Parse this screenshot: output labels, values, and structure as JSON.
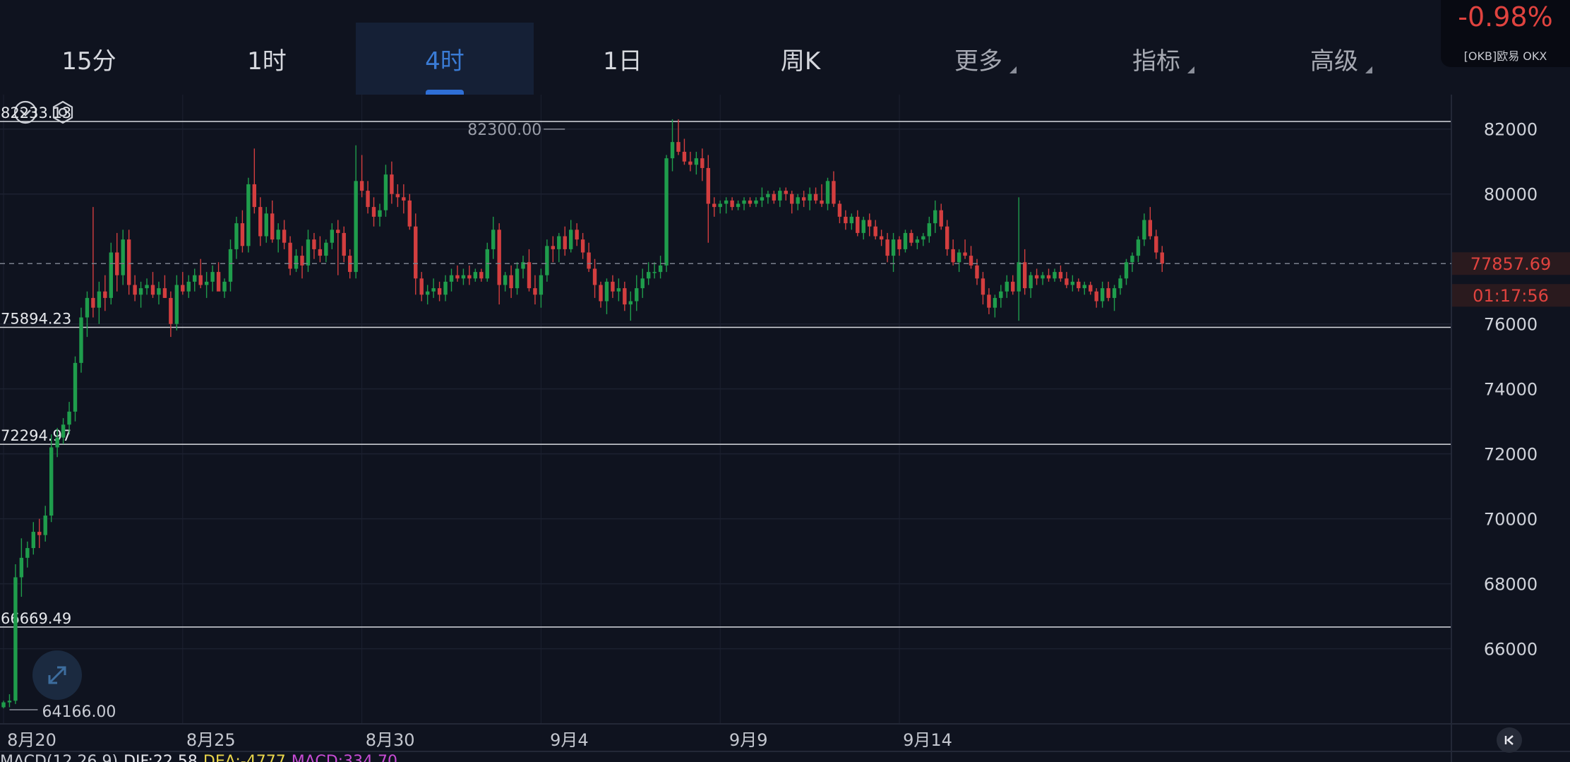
{
  "tabs": [
    {
      "label": "15分",
      "active": false
    },
    {
      "label": "1时",
      "active": false
    },
    {
      "label": "4时",
      "active": true
    },
    {
      "label": "1日",
      "active": false
    },
    {
      "label": "周K",
      "active": false
    },
    {
      "label": "更多",
      "active": false,
      "dropdown": true
    },
    {
      "label": "指标",
      "active": false,
      "dropdown": true
    },
    {
      "label": "高级",
      "active": false,
      "dropdown": true
    }
  ],
  "ticker": {
    "change": "-0.98%",
    "source": "[OKB]欧易 OKX",
    "change_color": "#e0433f"
  },
  "icons": {
    "collapse": "chevron-down-circle-icon",
    "settings": "hexagon-settings-icon",
    "expand": "expand-arrows-icon",
    "back": "skip-to-start-icon"
  },
  "macd": {
    "label": "MACD(12,26,9)",
    "dif": "DIF:22.58",
    "dea": "DEA:-4777",
    "macd": "MACD:334.70"
  },
  "colors": {
    "up": "#1f9d4c",
    "down": "#d33e3f",
    "background": "#0f131f",
    "grid": "#1c2130"
  },
  "chart_data": {
    "type": "candlestick",
    "y_ticks": [
      82000,
      80000,
      76000,
      74000,
      72000,
      70000,
      68000,
      66000
    ],
    "ylim": [
      63500,
      83500
    ],
    "x_ticks": [
      {
        "label": "8月20",
        "index": 0
      },
      {
        "label": "8月25",
        "index": 30
      },
      {
        "label": "8月30",
        "index": 60
      },
      {
        "label": "9月4",
        "index": 90
      },
      {
        "label": "9月9",
        "index": 120
      },
      {
        "label": "9月14",
        "index": 150
      }
    ],
    "levels": [
      {
        "label": "82233.13",
        "value": 82233.13
      },
      {
        "label": "75894.23",
        "value": 75894.23
      },
      {
        "label": "72294.97",
        "value": 72294.97
      },
      {
        "label": "66669.49",
        "value": 66669.49
      }
    ],
    "current_price": {
      "value": 77857.69,
      "label": "77857.69",
      "countdown": "01:17:56"
    },
    "high_marker": {
      "label": "82300.00",
      "value": 82300,
      "index": 94
    },
    "low_marker": {
      "label": "64166.00",
      "value": 64166,
      "index": 1
    },
    "candles_ohlc": [
      [
        64200,
        64400,
        64166,
        64350
      ],
      [
        64350,
        64600,
        64200,
        64400
      ],
      [
        64400,
        68600,
        64300,
        68200
      ],
      [
        68200,
        69400,
        67600,
        68800
      ],
      [
        68800,
        69300,
        68500,
        69100
      ],
      [
        69100,
        69900,
        68900,
        69600
      ],
      [
        69600,
        70000,
        69100,
        69500
      ],
      [
        69500,
        70400,
        69300,
        70100
      ],
      [
        70100,
        72600,
        69900,
        72200
      ],
      [
        72200,
        72800,
        71900,
        72500
      ],
      [
        72500,
        73100,
        72300,
        72900
      ],
      [
        72900,
        73600,
        72600,
        73300
      ],
      [
        73300,
        75000,
        73000,
        74800
      ],
      [
        74800,
        76500,
        74500,
        76200
      ],
      [
        76200,
        77000,
        75600,
        76800
      ],
      [
        76800,
        79600,
        76200,
        76500
      ],
      [
        76500,
        77300,
        76000,
        77000
      ],
      [
        77000,
        77500,
        76400,
        76800
      ],
      [
        76800,
        78500,
        76600,
        78200
      ],
      [
        78200,
        78800,
        77000,
        77500
      ],
      [
        77500,
        78900,
        77200,
        78600
      ],
      [
        78600,
        78900,
        76900,
        77200
      ],
      [
        77200,
        77500,
        76700,
        76900
      ],
      [
        76900,
        77300,
        76500,
        77100
      ],
      [
        77100,
        77400,
        76900,
        77200
      ],
      [
        77200,
        77600,
        76800,
        76900
      ],
      [
        76900,
        77300,
        76600,
        77100
      ],
      [
        77100,
        77500,
        76800,
        76800
      ],
      [
        76800,
        77000,
        75600,
        76000
      ],
      [
        76000,
        77500,
        75800,
        77200
      ],
      [
        77200,
        77600,
        76900,
        77000
      ],
      [
        77000,
        77500,
        76800,
        77300
      ],
      [
        77300,
        77700,
        77000,
        77500
      ],
      [
        77500,
        78000,
        77100,
        77200
      ],
      [
        77200,
        77600,
        76800,
        77300
      ],
      [
        77300,
        77800,
        77000,
        77600
      ],
      [
        77600,
        77900,
        77100,
        77000
      ],
      [
        77000,
        77400,
        76800,
        77300
      ],
      [
        77300,
        78600,
        77000,
        78300
      ],
      [
        78300,
        79300,
        78000,
        79100
      ],
      [
        79100,
        79500,
        78200,
        78400
      ],
      [
        78400,
        80500,
        78200,
        80300
      ],
      [
        80300,
        81400,
        79400,
        79600
      ],
      [
        79600,
        79900,
        78400,
        78700
      ],
      [
        78700,
        79600,
        78500,
        79400
      ],
      [
        79400,
        79800,
        78500,
        78600
      ],
      [
        78600,
        79100,
        78200,
        78900
      ],
      [
        78900,
        79200,
        78300,
        78500
      ],
      [
        78500,
        78700,
        77500,
        77700
      ],
      [
        77700,
        78300,
        77600,
        78100
      ],
      [
        78100,
        78400,
        77400,
        77800
      ],
      [
        77800,
        78900,
        77600,
        78600
      ],
      [
        78600,
        78800,
        78000,
        78300
      ],
      [
        78300,
        78700,
        77900,
        78100
      ],
      [
        78100,
        78600,
        77900,
        78500
      ],
      [
        78500,
        79100,
        78300,
        78900
      ],
      [
        78900,
        79200,
        77500,
        78800
      ],
      [
        78800,
        79000,
        77900,
        78100
      ],
      [
        78100,
        78300,
        77400,
        77600
      ],
      [
        77600,
        81500,
        77400,
        80400
      ],
      [
        80400,
        81200,
        79900,
        80100
      ],
      [
        80100,
        80400,
        79400,
        79600
      ],
      [
        79600,
        79900,
        79000,
        79300
      ],
      [
        79300,
        79700,
        79000,
        79500
      ],
      [
        79500,
        80900,
        79300,
        80600
      ],
      [
        80600,
        81000,
        79700,
        80000
      ],
      [
        80000,
        80300,
        79600,
        79900
      ],
      [
        79900,
        80300,
        79400,
        79800
      ],
      [
        79800,
        80000,
        78900,
        79000
      ],
      [
        79000,
        79400,
        76900,
        77400
      ],
      [
        77400,
        77600,
        76700,
        76900
      ],
      [
        76900,
        77200,
        76600,
        77000
      ],
      [
        77000,
        77400,
        76800,
        77100
      ],
      [
        77100,
        77300,
        76700,
        76900
      ],
      [
        76900,
        77500,
        76700,
        77300
      ],
      [
        77300,
        77700,
        77000,
        77500
      ],
      [
        77500,
        77800,
        77300,
        77400
      ],
      [
        77400,
        77700,
        77200,
        77500
      ],
      [
        77500,
        77800,
        77200,
        77400
      ],
      [
        77400,
        77700,
        77300,
        77600
      ],
      [
        77600,
        77700,
        77300,
        77400
      ],
      [
        77400,
        78500,
        77300,
        78300
      ],
      [
        78300,
        79300,
        78000,
        78900
      ],
      [
        78900,
        79100,
        76600,
        77200
      ],
      [
        77200,
        77600,
        77000,
        77500
      ],
      [
        77500,
        77800,
        76800,
        77100
      ],
      [
        77100,
        77900,
        76900,
        77700
      ],
      [
        77700,
        78100,
        77400,
        77900
      ],
      [
        77900,
        78300,
        77000,
        77100
      ],
      [
        77100,
        77500,
        76600,
        76900
      ],
      [
        76900,
        77700,
        76500,
        77500
      ],
      [
        77500,
        78600,
        77300,
        78400
      ],
      [
        78400,
        78700,
        77900,
        78300
      ],
      [
        78300,
        78800,
        77900,
        78700
      ],
      [
        78700,
        79000,
        78100,
        78300
      ],
      [
        78300,
        79200,
        78200,
        78900
      ],
      [
        78900,
        79100,
        78400,
        78600
      ],
      [
        78600,
        78800,
        78000,
        78200
      ],
      [
        78200,
        78500,
        77600,
        77700
      ],
      [
        77700,
        78000,
        76800,
        77200
      ],
      [
        77200,
        77300,
        76500,
        76700
      ],
      [
        76700,
        77400,
        76300,
        77300
      ],
      [
        77300,
        77500,
        76800,
        77000
      ],
      [
        77000,
        77400,
        76700,
        77100
      ],
      [
        77100,
        77300,
        76400,
        76600
      ],
      [
        76600,
        77000,
        76100,
        76700
      ],
      [
        76700,
        77500,
        76400,
        77100
      ],
      [
        77100,
        77700,
        76800,
        77400
      ],
      [
        77400,
        77900,
        77200,
        77600
      ],
      [
        77600,
        77900,
        77400,
        77600
      ],
      [
        77600,
        78100,
        77400,
        77800
      ],
      [
        77800,
        81200,
        77600,
        81100
      ],
      [
        81100,
        82300,
        80700,
        81600
      ],
      [
        81600,
        82300,
        81200,
        81300
      ],
      [
        81300,
        81700,
        80900,
        81000
      ],
      [
        81000,
        81300,
        80700,
        80900
      ],
      [
        80900,
        81300,
        80600,
        81100
      ],
      [
        81100,
        81400,
        80400,
        80800
      ],
      [
        80800,
        81200,
        78500,
        79700
      ],
      [
        79700,
        79900,
        79300,
        79600
      ],
      [
        79600,
        79800,
        79400,
        79700
      ],
      [
        79700,
        79900,
        79400,
        79800
      ],
      [
        79800,
        79900,
        79500,
        79600
      ],
      [
        79600,
        79800,
        79500,
        79700
      ],
      [
        79700,
        79900,
        79500,
        79800
      ],
      [
        79800,
        79900,
        79600,
        79700
      ],
      [
        79700,
        79900,
        79600,
        79800
      ],
      [
        79800,
        80200,
        79600,
        79900
      ],
      [
        79900,
        80100,
        79700,
        80000
      ],
      [
        80000,
        80100,
        79700,
        79800
      ],
      [
        79800,
        80200,
        79600,
        80100
      ],
      [
        80100,
        80200,
        79800,
        80000
      ],
      [
        80000,
        80100,
        79400,
        79700
      ],
      [
        79700,
        80000,
        79500,
        79900
      ],
      [
        79900,
        80100,
        79600,
        79800
      ],
      [
        79800,
        80200,
        79500,
        80000
      ],
      [
        80000,
        80200,
        79700,
        79800
      ],
      [
        79800,
        80300,
        79600,
        79700
      ],
      [
        79700,
        80500,
        79500,
        80400
      ],
      [
        80400,
        80700,
        79600,
        79700
      ],
      [
        79700,
        79800,
        79100,
        79300
      ],
      [
        79300,
        79500,
        78900,
        79100
      ],
      [
        79100,
        79400,
        78900,
        79300
      ],
      [
        79300,
        79500,
        78700,
        78800
      ],
      [
        78800,
        79300,
        78600,
        79200
      ],
      [
        79200,
        79400,
        78700,
        79000
      ],
      [
        79000,
        79200,
        78600,
        78700
      ],
      [
        78700,
        78900,
        78400,
        78600
      ],
      [
        78600,
        78800,
        77900,
        78100
      ],
      [
        78100,
        78800,
        77600,
        78600
      ],
      [
        78600,
        78700,
        78100,
        78300
      ],
      [
        78300,
        78900,
        78200,
        78800
      ],
      [
        78800,
        78900,
        78400,
        78500
      ],
      [
        78500,
        78700,
        78300,
        78600
      ],
      [
        78600,
        78800,
        78400,
        78700
      ],
      [
        78700,
        79300,
        78500,
        79100
      ],
      [
        79100,
        79800,
        78800,
        79500
      ],
      [
        79500,
        79700,
        78900,
        79000
      ],
      [
        79000,
        79200,
        78100,
        78300
      ],
      [
        78300,
        78600,
        77800,
        77900
      ],
      [
        77900,
        78300,
        77600,
        78200
      ],
      [
        78200,
        78600,
        78000,
        78100
      ],
      [
        78100,
        78400,
        77700,
        77800
      ],
      [
        77800,
        78000,
        77200,
        77400
      ],
      [
        77400,
        77600,
        76600,
        76900
      ],
      [
        76900,
        77100,
        76300,
        76500
      ],
      [
        76500,
        76900,
        76200,
        76800
      ],
      [
        76800,
        77200,
        76500,
        77000
      ],
      [
        77000,
        77500,
        76800,
        77300
      ],
      [
        77300,
        77500,
        76900,
        77000
      ],
      [
        77000,
        79900,
        76100,
        77900
      ],
      [
        77900,
        78300,
        76900,
        77100
      ],
      [
        77100,
        77600,
        76800,
        77500
      ],
      [
        77500,
        77700,
        77200,
        77400
      ],
      [
        77400,
        77600,
        77200,
        77500
      ],
      [
        77500,
        77700,
        77300,
        77400
      ],
      [
        77400,
        77700,
        77300,
        77600
      ],
      [
        77600,
        77800,
        77300,
        77400
      ],
      [
        77400,
        77600,
        77100,
        77200
      ],
      [
        77200,
        77500,
        77000,
        77300
      ],
      [
        77300,
        77400,
        77000,
        77100
      ],
      [
        77100,
        77300,
        76900,
        77200
      ],
      [
        77200,
        77300,
        76900,
        77000
      ],
      [
        77000,
        77100,
        76500,
        76700
      ],
      [
        76700,
        77300,
        76500,
        77100
      ],
      [
        77100,
        77300,
        76700,
        76800
      ],
      [
        76800,
        77200,
        76400,
        77100
      ],
      [
        77100,
        77500,
        76900,
        77400
      ],
      [
        77400,
        78000,
        77200,
        77900
      ],
      [
        77900,
        78200,
        77600,
        78100
      ],
      [
        78100,
        78700,
        77900,
        78600
      ],
      [
        78600,
        79400,
        78400,
        79200
      ],
      [
        79200,
        79600,
        78600,
        78700
      ],
      [
        78700,
        78900,
        78000,
        78200
      ],
      [
        78200,
        78400,
        77600,
        77858
      ]
    ]
  }
}
